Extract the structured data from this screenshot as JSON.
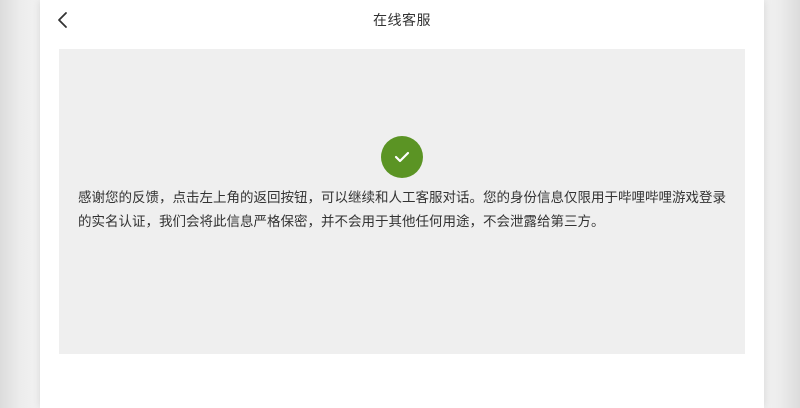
{
  "header": {
    "title": "在线客服"
  },
  "result": {
    "status": "success",
    "message": "感谢您的反馈，点击左上角的返回按钮，可以继续和人工客服对话。您的身份信息仅限用于哔哩哔哩游戏登录的实名认证，我们会将此信息严格保密，并不会用于其他任何用途，不会泄露给第三方。"
  },
  "icons": {
    "back": "chevron-left-icon",
    "success": "check-icon"
  },
  "colors": {
    "success_green": "#5b9424",
    "card_bg": "#efefef",
    "text": "#333333"
  }
}
